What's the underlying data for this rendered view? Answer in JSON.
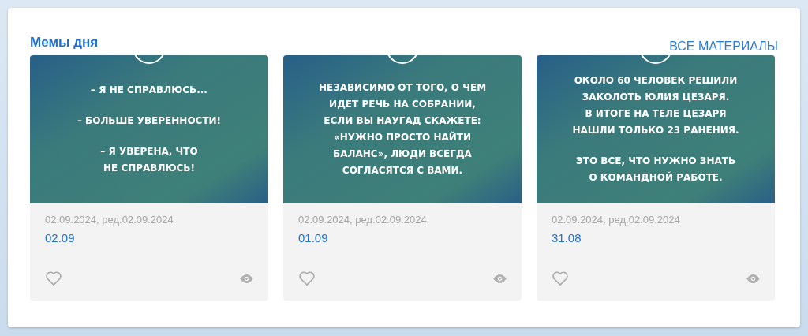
{
  "section": {
    "title": "Мемы дня",
    "link": "ВСЕ МАТЕРИАЛЫ"
  },
  "cards": [
    {
      "meme": [
        "– Я НЕ СПРАВЛЮСЬ...",
        "– БОЛЬШЕ УВЕРЕННОСТИ!",
        "– Я УВЕРЕНА, ЧТО\nНЕ СПРАВЛЮСЬ!"
      ],
      "dates": "02.09.2024, ред.02.09.2024",
      "title": "02.09",
      "liked": false
    },
    {
      "meme": [
        "НЕЗАВИСИМО ОТ ТОГО, О ЧЕМ\nИДЕТ РЕЧЬ НА СОБРАНИИ,\nЕСЛИ ВЫ НАУГАД СКАЖЕТЕ:\n«НУЖНО ПРОСТО НАЙТИ\nБАЛАНС», ЛЮДИ ВСЕГДА\nСОГЛАСЯТСЯ С ВАМИ."
      ],
      "dates": "02.09.2024, ред.02.09.2024",
      "title": "01.09",
      "liked": false
    },
    {
      "meme": [
        "ОКОЛО 60 ЧЕЛОВЕК РЕШИЛИ\nЗАКОЛОТЬ ЮЛИЯ ЦЕЗАРЯ.\nВ ИТОГЕ НА ТЕЛЕ ЦЕЗАРЯ\nНАШЛИ ТОЛЬКО 23 РАНЕНИЯ.",
        "ЭТО ВСЕ, ЧТО НУЖНО ЗНАТЬ\nО КОМАНДНОЙ РАБОТЕ."
      ],
      "dates": "02.09.2024, ред.02.09.2024",
      "title": "31.08",
      "liked": false
    }
  ]
}
